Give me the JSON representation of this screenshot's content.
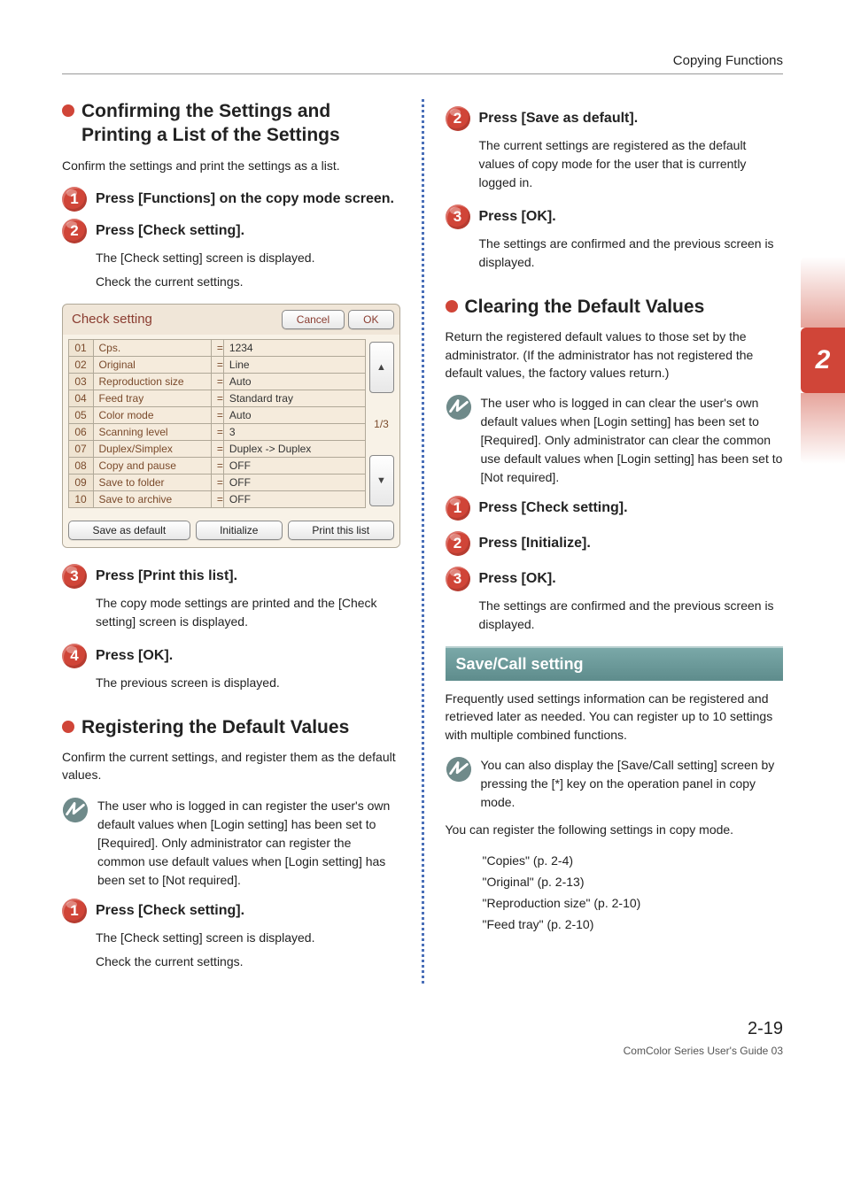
{
  "doc": {
    "header": "Copying Functions",
    "chapter_tab": "2",
    "page_number": "2-19",
    "footer": "ComColor Series User's Guide 03"
  },
  "left": {
    "sec1": {
      "title": "Confirming the Settings and Printing a List of the Settings",
      "intro": "Confirm the settings and print the settings as a list.",
      "steps": {
        "1": {
          "title": "Press [Functions] on the copy mode screen."
        },
        "2": {
          "title": "Press [Check setting].",
          "body1": "The [Check setting] screen is displayed.",
          "body2": "Check the current settings."
        },
        "3": {
          "title": "Press [Print this list].",
          "body": "The copy mode settings are printed and the [Check setting] screen is displayed."
        },
        "4": {
          "title": "Press [OK].",
          "body": "The previous screen is displayed."
        }
      }
    },
    "panel": {
      "title": "Check setting",
      "buttons": {
        "cancel": "Cancel",
        "ok": "OK"
      },
      "page_indicator": "1/3",
      "scroll_up": "▲",
      "scroll_down": "▼",
      "rows": [
        {
          "idx": "01",
          "name": "Cps.",
          "val": "1234"
        },
        {
          "idx": "02",
          "name": "Original",
          "val": "Line"
        },
        {
          "idx": "03",
          "name": "Reproduction size",
          "val": "Auto"
        },
        {
          "idx": "04",
          "name": "Feed tray",
          "val": "Standard tray"
        },
        {
          "idx": "05",
          "name": "Color mode",
          "val": "Auto"
        },
        {
          "idx": "06",
          "name": "Scanning level",
          "val": "3"
        },
        {
          "idx": "07",
          "name": "Duplex/Simplex",
          "val": "Duplex -> Duplex"
        },
        {
          "idx": "08",
          "name": "Copy and pause",
          "val": "OFF"
        },
        {
          "idx": "09",
          "name": "Save to folder",
          "val": "OFF"
        },
        {
          "idx": "10",
          "name": "Save to archive",
          "val": "OFF"
        }
      ],
      "eq": "=",
      "footer": {
        "save_default": "Save as default",
        "initialize": "Initialize",
        "print_list": "Print this list"
      }
    },
    "sec2": {
      "title": "Registering the Default Values",
      "intro": "Confirm the current settings, and register them as the default values.",
      "note": "The user who is logged in can register the user's own default values when [Login setting] has been set to [Required]. Only administrator can register the common use default values when [Login setting] has been set to [Not required].",
      "steps": {
        "1": {
          "title": "Press [Check setting].",
          "body1": "The [Check setting] screen is displayed.",
          "body2": "Check the current settings."
        }
      }
    }
  },
  "right": {
    "cont_steps": {
      "2": {
        "title": "Press [Save as default].",
        "body": "The current settings are registered as the default values of copy mode for the user that is currently logged in."
      },
      "3": {
        "title": "Press [OK].",
        "body": "The settings are confirmed and the previous screen is displayed."
      }
    },
    "sec3": {
      "title": "Clearing the Default Values",
      "intro": "Return the registered default values to those set by the administrator. (If the administrator has not registered the default values, the factory values return.)",
      "note": "The user who is logged in can clear the user's own default values when [Login setting] has been set to [Required]. Only administrator can clear the common use default values when [Login setting] has been set to [Not required].",
      "steps": {
        "1": {
          "title": "Press [Check setting]."
        },
        "2": {
          "title": "Press [Initialize]."
        },
        "3": {
          "title": "Press [OK].",
          "body": "The settings are confirmed and the previous screen is displayed."
        }
      }
    },
    "sec4": {
      "title": "Save/Call setting",
      "intro": "Frequently used settings information can be registered and retrieved later as needed. You can register up to 10 settings with multiple combined functions.",
      "note": "You can also display the [Save/Call setting] screen by pressing the [*] key on the operation panel in copy mode.",
      "lead": "You can register the following settings in copy mode.",
      "refs": [
        "\"Copies\" (p. 2-4)",
        "\"Original\" (p. 2-13)",
        "\"Reproduction size\" (p. 2-10)",
        "\"Feed tray\" (p. 2-10)"
      ]
    }
  }
}
